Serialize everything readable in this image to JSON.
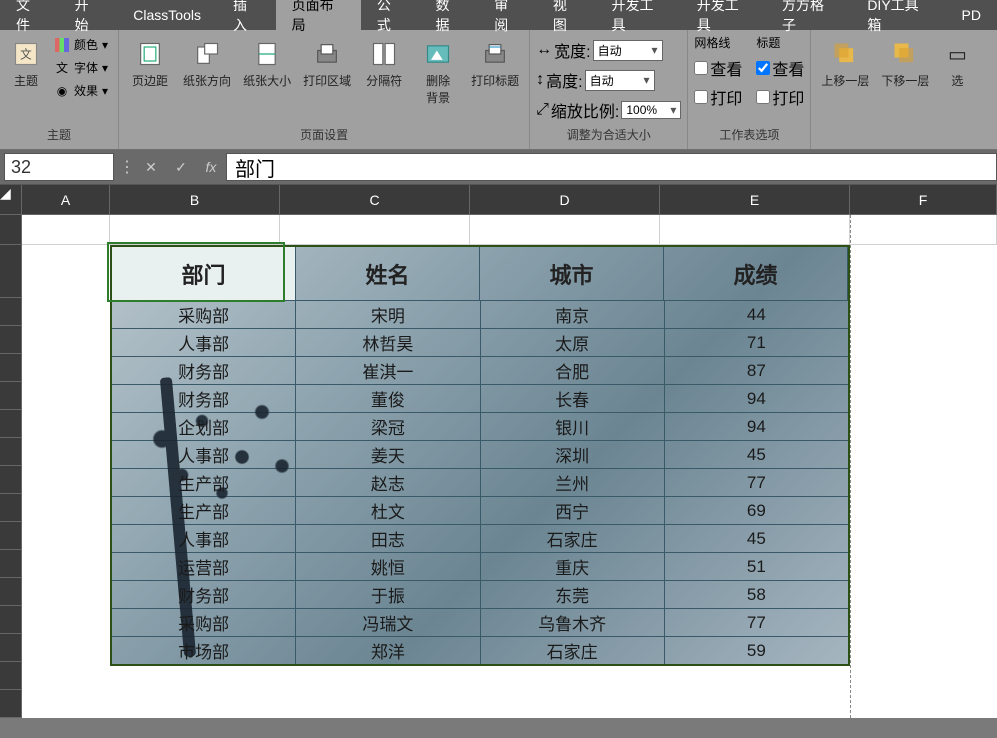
{
  "menu": {
    "items": [
      "文件",
      "开始",
      "ClassTools",
      "插入",
      "页面布局",
      "公式",
      "数据",
      "审阅",
      "视图",
      "开发工具",
      "开发工具",
      "方方格子",
      "DIY工具箱",
      "PD"
    ],
    "active_index": 4
  },
  "ribbon": {
    "theme": {
      "title": "主题",
      "colors": "颜色",
      "fonts": "字体",
      "effects": "效果",
      "themes": "主题"
    },
    "page_setup": {
      "title": "页面设置",
      "margins": "页边距",
      "orientation": "纸张方向",
      "size": "纸张大小",
      "print_area": "打印区域",
      "breaks": "分隔符",
      "background": "删除\n背景",
      "print_titles": "打印标题"
    },
    "scale": {
      "title": "调整为合适大小",
      "width": "宽度:",
      "height": "高度:",
      "scale": "缩放比例:",
      "width_val": "自动",
      "height_val": "自动",
      "scale_val": "100%"
    },
    "sheet_options": {
      "title": "工作表选项",
      "gridlines": "网格线",
      "headings": "标题",
      "view": "查看",
      "print": "打印",
      "gridlines_view": false,
      "gridlines_print": false,
      "headings_view": true,
      "headings_print": false
    },
    "arrange": {
      "forward": "上移一层",
      "backward": "下移一层",
      "select": "选"
    }
  },
  "formula_bar": {
    "name_box": "32",
    "formula": "部门",
    "fx": "fx"
  },
  "columns": [
    "A",
    "B",
    "C",
    "D",
    "E",
    "F"
  ],
  "sheet": {
    "headers": [
      "部门",
      "姓名",
      "城市",
      "成绩"
    ],
    "rows": [
      {
        "dept": "采购部",
        "name": "宋明",
        "city": "南京",
        "score": "44"
      },
      {
        "dept": "人事部",
        "name": "林哲昊",
        "city": "太原",
        "score": "71"
      },
      {
        "dept": "财务部",
        "name": "崔淇一",
        "city": "合肥",
        "score": "87"
      },
      {
        "dept": "财务部",
        "name": "董俊",
        "city": "长春",
        "score": "94"
      },
      {
        "dept": "企划部",
        "name": "梁冠",
        "city": "银川",
        "score": "94"
      },
      {
        "dept": "人事部",
        "name": "姜天",
        "city": "深圳",
        "score": "45"
      },
      {
        "dept": "生产部",
        "name": "赵志",
        "city": "兰州",
        "score": "77"
      },
      {
        "dept": "生产部",
        "name": "杜文",
        "city": "西宁",
        "score": "69"
      },
      {
        "dept": "人事部",
        "name": "田志",
        "city": "石家庄",
        "score": "45"
      },
      {
        "dept": "运营部",
        "name": "姚恒",
        "city": "重庆",
        "score": "51"
      },
      {
        "dept": "财务部",
        "name": "于振",
        "city": "东莞",
        "score": "58"
      },
      {
        "dept": "采购部",
        "name": "冯瑞文",
        "city": "乌鲁木齐",
        "score": "77"
      },
      {
        "dept": "市场部",
        "name": "郑洋",
        "city": "石家庄",
        "score": "59"
      }
    ]
  }
}
